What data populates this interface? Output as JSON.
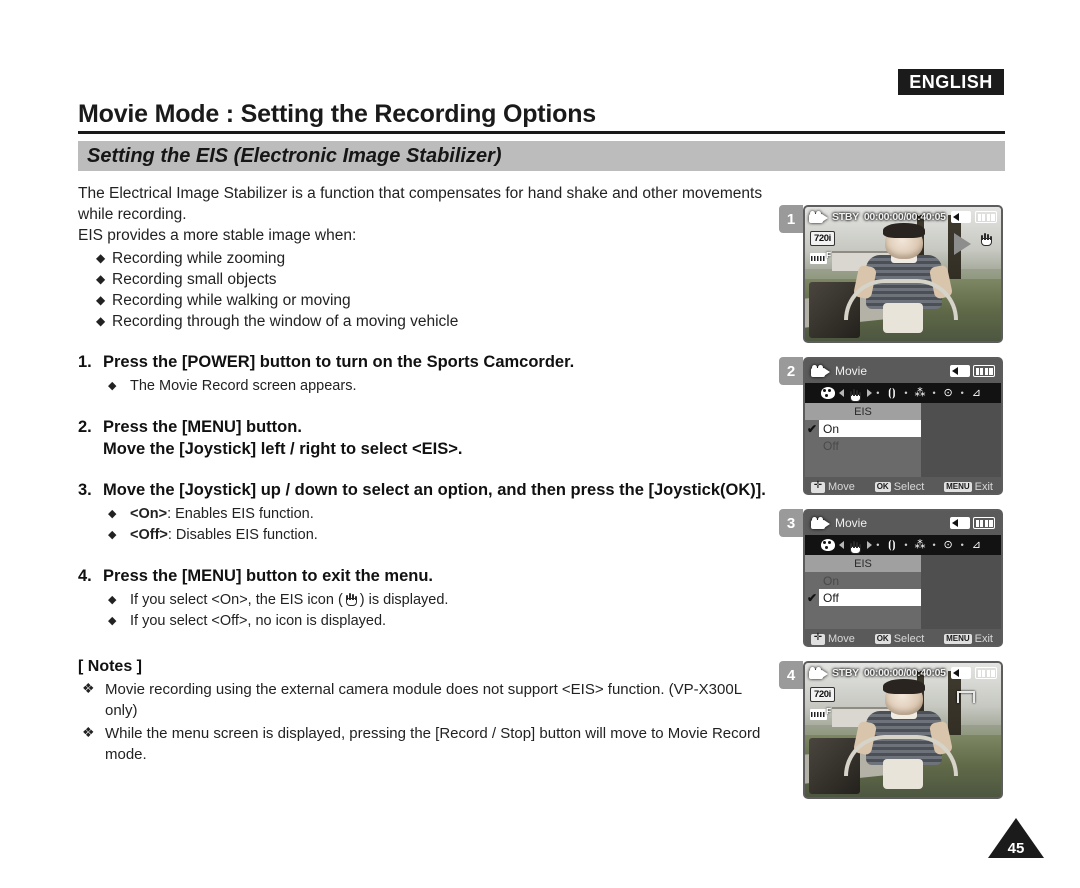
{
  "header": {
    "language_badge": "ENGLISH",
    "title": "Movie Mode : Setting the Recording Options",
    "section_title": "Setting the EIS (Electronic Image Stabilizer)"
  },
  "intro": {
    "paragraph": "The Electrical Image Stabilizer is a function that compensates for hand shake and other movements while recording.",
    "lead_in": "EIS provides a more stable image when:",
    "bullets": [
      "Recording while zooming",
      "Recording small objects",
      "Recording while walking or moving",
      "Recording through the  window of a moving vehicle"
    ]
  },
  "steps": [
    {
      "number": "1.",
      "text": "Press the [POWER] button to turn on the Sports Camcorder.",
      "subs": [
        "The Movie Record screen appears."
      ]
    },
    {
      "number": "2.",
      "text": "Press the [MENU] button.",
      "text2": "Move the [Joystick] left / right to select <EIS>.",
      "subs": []
    },
    {
      "number": "3.",
      "text": "Move the [Joystick] up / down to select an option, and then press the [Joystick(OK)].",
      "subs_rich": [
        {
          "bold": "<On>",
          "rest": ": Enables EIS function."
        },
        {
          "bold": "<Off>",
          "rest": ": Disables EIS function."
        }
      ]
    },
    {
      "number": "4.",
      "text": "Press the [MENU] button to exit the menu.",
      "subs_rich2": [
        {
          "pre": "If you select <On>, the EIS icon (",
          "post": ") is displayed."
        }
      ],
      "sub_last": "If you select <Off>, no icon is displayed."
    }
  ],
  "notes": {
    "title": "[ Notes ]",
    "items": [
      "Movie recording using the external camera module does not support <EIS> function. (VP-X300L only)",
      "While the menu screen is displayed, pressing the [Record / Stop] button will move to Movie Record mode."
    ]
  },
  "screens": [
    {
      "step": "1",
      "type": "record",
      "osd_status": "STBY",
      "osd_time": "00:00:00/00:40:05",
      "resolution": "720i",
      "quality": "F",
      "eis_icon_visible": true,
      "icons": [
        "camcorder-icon",
        "speaker-icon",
        "battery-icon",
        "eis-hand-icon",
        "play-triangle-icon"
      ]
    },
    {
      "step": "2",
      "type": "menu",
      "menu_title": "Movie",
      "column_header": "EIS",
      "options": [
        {
          "label": "On",
          "selected": true
        },
        {
          "label": "Off",
          "selected": false
        }
      ],
      "bottom_bar": [
        {
          "key": "joystick",
          "label": "Move"
        },
        {
          "key": "OK",
          "label": "Select"
        },
        {
          "key": "MENU",
          "label": "Exit"
        }
      ],
      "icon_row": [
        "palette-icon",
        "eis-hand-icon",
        "focus-icon",
        "effect-icon",
        "program-ae-icon",
        "white-balance-icon"
      ]
    },
    {
      "step": "3",
      "type": "menu",
      "menu_title": "Movie",
      "column_header": "EIS",
      "options": [
        {
          "label": "On",
          "selected": false
        },
        {
          "label": "Off",
          "selected": true
        }
      ],
      "bottom_bar": [
        {
          "key": "joystick",
          "label": "Move"
        },
        {
          "key": "OK",
          "label": "Select"
        },
        {
          "key": "MENU",
          "label": "Exit"
        }
      ],
      "icon_row": [
        "palette-icon",
        "eis-hand-icon",
        "focus-icon",
        "effect-icon",
        "program-ae-icon",
        "white-balance-icon"
      ]
    },
    {
      "step": "4",
      "type": "record",
      "osd_status": "STBY",
      "osd_time": "00:00:00/00:40:05",
      "resolution": "720i",
      "quality": "F",
      "eis_icon_visible": false,
      "icons": [
        "camcorder-icon",
        "speaker-icon",
        "battery-icon",
        "wind-cut-icon"
      ]
    }
  ],
  "footer": {
    "page_number": "45"
  },
  "colors": {
    "section_bar": "#bcbcbc",
    "badge_black": "#1b1b1b",
    "menu_bg": "#4f4f4f",
    "menu_highlight": "#ffffff"
  }
}
